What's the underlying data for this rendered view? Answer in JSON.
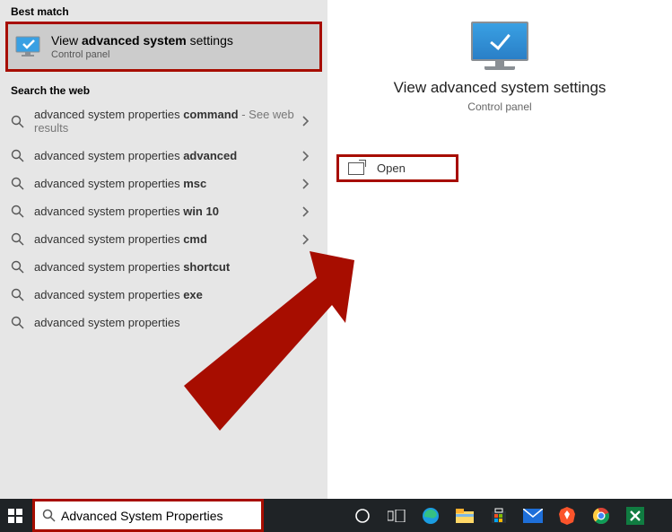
{
  "sections": {
    "best_match_header": "Best match",
    "search_web_header": "Search the web"
  },
  "best_match": {
    "title_pre": "View ",
    "title_bold": "advanced system",
    "title_post": " settings",
    "subtitle": "Control panel"
  },
  "web_results": [
    {
      "pre": "advanced system properties ",
      "bold": "command",
      "hint": " - See web results",
      "chevron": true
    },
    {
      "pre": "advanced system properties ",
      "bold": "advanced",
      "hint": "",
      "chevron": true
    },
    {
      "pre": "advanced system properties ",
      "bold": "msc",
      "hint": "",
      "chevron": true
    },
    {
      "pre": "advanced system properties ",
      "bold": "win 10",
      "hint": "",
      "chevron": true
    },
    {
      "pre": "advanced system properties ",
      "bold": "cmd",
      "hint": "",
      "chevron": true
    },
    {
      "pre": "advanced system properties ",
      "bold": "shortcut",
      "hint": "",
      "chevron": false
    },
    {
      "pre": "advanced system properties ",
      "bold": "exe",
      "hint": "",
      "chevron": false
    },
    {
      "pre": "advanced system properties",
      "bold": "",
      "hint": "",
      "chevron": true
    }
  ],
  "detail": {
    "title": "View advanced system settings",
    "subtitle": "Control panel",
    "open_label": "Open"
  },
  "search_box": {
    "value": "Advanced System Properties"
  },
  "annotations": {
    "highlight_color": "#a70d00"
  }
}
